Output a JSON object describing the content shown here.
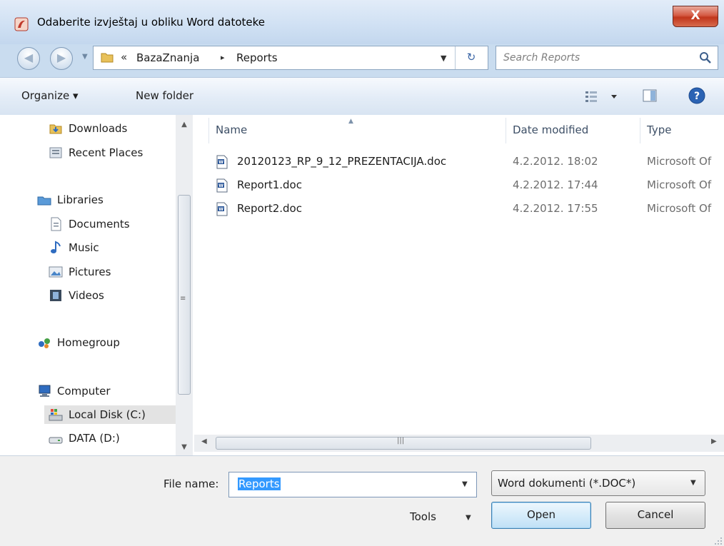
{
  "window": {
    "title": "Odaberite izvještaj u obliku Word datoteke",
    "close_label": "X"
  },
  "address": {
    "overflow": "«",
    "segments": [
      "BazaZnanja",
      "Reports"
    ],
    "separator": "▸"
  },
  "search": {
    "placeholder": "Search Reports"
  },
  "toolbar": {
    "organize_label": "Organize ▾",
    "new_folder_label": "New folder"
  },
  "sidebar": {
    "items": [
      {
        "label": "Downloads",
        "icon": "downloads-icon"
      },
      {
        "label": "Recent Places",
        "icon": "recent-places-icon"
      },
      {
        "label": "Libraries",
        "icon": "libraries-icon"
      },
      {
        "label": "Documents",
        "icon": "documents-icon"
      },
      {
        "label": "Music",
        "icon": "music-icon"
      },
      {
        "label": "Pictures",
        "icon": "pictures-icon"
      },
      {
        "label": "Videos",
        "icon": "videos-icon"
      },
      {
        "label": "Homegroup",
        "icon": "homegroup-icon"
      },
      {
        "label": "Computer",
        "icon": "computer-icon"
      },
      {
        "label": "Local Disk (C:)",
        "icon": "local-disk-icon"
      },
      {
        "label": "DATA (D:)",
        "icon": "data-drive-icon"
      }
    ],
    "selected_index": 9
  },
  "columns": {
    "name": "Name",
    "date_modified": "Date modified",
    "type": "Type"
  },
  "files": [
    {
      "name": "20120123_RP_9_12_PREZENTACIJA.doc",
      "date": "4.2.2012. 18:02",
      "type": "Microsoft Of"
    },
    {
      "name": "Report1.doc",
      "date": "4.2.2012. 17:44",
      "type": "Microsoft Of"
    },
    {
      "name": "Report2.doc",
      "date": "4.2.2012. 17:55",
      "type": "Microsoft Of"
    }
  ],
  "bottom": {
    "file_name_label": "File name:",
    "file_name_value": "Reports",
    "filter_value": "Word dokumenti (*.DOC*)",
    "tools_label": "Tools",
    "open_label": "Open",
    "cancel_label": "Cancel"
  },
  "colors": {
    "selection": "#3399ff",
    "close_button": "#c1361c"
  }
}
